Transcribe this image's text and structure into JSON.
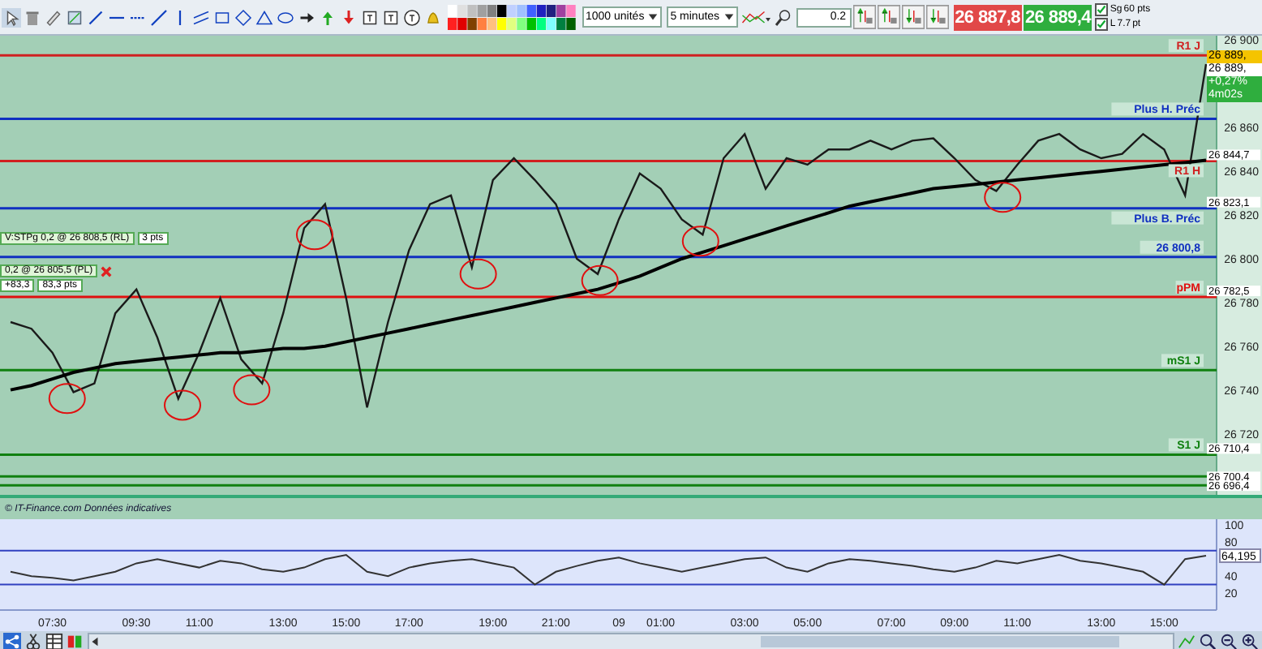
{
  "toolbar": {
    "quantity_select": "1000 unités",
    "interval_select": "5 minutes",
    "quantity_field": "0.2",
    "sell_price": "26 887,8",
    "buy_price": "26 889,4",
    "options": [
      {
        "label": "Sg",
        "checked": true,
        "value": "60 pts"
      },
      {
        "label": "L",
        "checked": true,
        "value": "7.7",
        "unit": "pt"
      }
    ]
  },
  "price_chart": {
    "chart_data": {
      "type": "line",
      "ylim": [
        26692,
        26902
      ],
      "yticks": [
        {
          "value": 26720,
          "label": "26 720"
        },
        {
          "value": 26740,
          "label": "26 740"
        },
        {
          "value": 26760,
          "label": "26 760"
        },
        {
          "value": 26780,
          "label": "26 780"
        },
        {
          "value": 26800,
          "label": "26 800"
        },
        {
          "value": 26820,
          "label": "26 820"
        },
        {
          "value": 26840,
          "label": "26 840"
        },
        {
          "value": 26860,
          "label": "26 860"
        },
        {
          "value": 26900,
          "label": "26 900"
        }
      ],
      "categories": [
        null,
        null,
        null,
        null,
        null,
        null,
        null,
        null,
        null,
        null,
        null,
        null,
        null,
        null,
        null,
        null,
        null,
        null,
        null,
        null,
        null,
        null,
        null,
        null,
        null,
        null,
        null,
        null,
        null,
        null,
        null,
        null,
        null,
        null,
        null,
        null,
        null,
        null,
        null,
        null,
        null,
        null,
        null,
        null,
        null,
        null,
        null,
        null,
        null,
        null,
        null,
        null,
        null,
        null,
        null,
        null,
        null,
        null
      ],
      "series": [
        {
          "color": "#1a1a1a",
          "values": [
            26771,
            26768,
            26757,
            26739,
            26743,
            26775,
            26786,
            26764,
            26736,
            26757,
            26782,
            26754,
            26743,
            26775,
            26814,
            26825,
            26782,
            26732,
            26771,
            26804,
            26825,
            26829,
            26796,
            26836,
            26846,
            26836,
            26825,
            26800,
            26793,
            26818,
            26839,
            26832,
            26818,
            26811,
            26846,
            26857,
            26832,
            26846,
            26843,
            26850,
            26850,
            26854,
            26850,
            26854,
            26855,
            26846,
            26836,
            26831,
            26843,
            26854,
            26857,
            26850,
            26846,
            26848,
            26857,
            26850,
            26829,
            26889
          ]
        },
        {
          "color": "#000000",
          "values": [
            26740,
            26742,
            26745,
            26748,
            26750,
            26752,
            26753,
            26754,
            26755,
            26756,
            26757,
            26757,
            26758,
            26759,
            26759,
            26760,
            26762,
            26764,
            26766,
            26768,
            26770,
            26772,
            26774,
            26776,
            26778,
            26780,
            26782,
            26784,
            26786,
            26789,
            26792,
            26796,
            26800,
            26803,
            26806,
            26809,
            26812,
            26815,
            26818,
            26821,
            26824,
            26826,
            26828,
            26830,
            26832,
            26833,
            26834,
            26835,
            26836,
            26837,
            26838,
            26839,
            26840,
            26841,
            26842,
            26843,
            26844,
            26845
          ]
        }
      ],
      "ref_lines": [
        {
          "axis": "y",
          "value": 26893,
          "label": "R1 J",
          "color": "#d02020"
        },
        {
          "axis": "y",
          "value": 26864,
          "label": "Plus H. Préc",
          "color": "#1030c0"
        },
        {
          "axis": "y",
          "value": 26844.7,
          "label": "R1 H",
          "color": "#d02020"
        },
        {
          "axis": "y",
          "value": 26823.1,
          "label": "Plus B. Préc",
          "color": "#1030c0"
        },
        {
          "axis": "y",
          "value": 26800.8,
          "label": "26 800,8",
          "color": "#1030c0"
        },
        {
          "axis": "y",
          "value": 26782.5,
          "label": "pPM",
          "color": "#e01010"
        },
        {
          "axis": "y",
          "value": 26749,
          "label": "mS1 J",
          "color": "#108010"
        },
        {
          "axis": "y",
          "value": 26710.4,
          "label": "S1 J",
          "color": "#108010"
        },
        {
          "axis": "y",
          "value": 26700.4,
          "color": "#108010"
        },
        {
          "axis": "y",
          "value": 26696.4,
          "color": "#108010"
        }
      ],
      "annotations": [
        "26 844,7",
        "26 823,1",
        "26 782,5",
        "26 710,4",
        "26 700,4",
        "26 696,4"
      ]
    },
    "readouts": [
      {
        "text": "26 889,",
        "kind": "last"
      },
      {
        "text": "26 889,",
        "kind": "plain"
      },
      {
        "text": "+0,27%",
        "kind": "change"
      },
      {
        "text": "4m02s",
        "kind": "change"
      }
    ],
    "orders": [
      {
        "label": "V:STPg 0,2 @ 26 808,5 (RL)",
        "value": "3 pts",
        "closable": false
      },
      {
        "label": "0,2 @ 26 805,5 (PL)",
        "value": "+83,3",
        "extra": "83,3 pts",
        "closable": true
      }
    ]
  },
  "source_note": "© IT-Finance.com Données indicatives",
  "oscillator": {
    "reading": "64,195",
    "chart_data": {
      "type": "line",
      "ylim": [
        0,
        107
      ],
      "yticks": [
        20,
        40,
        80,
        100
      ],
      "categories": [
        null,
        null,
        "07:30",
        null,
        null,
        null,
        "09:30",
        null,
        null,
        "11:00",
        null,
        null,
        null,
        "13:00",
        null,
        null,
        "15:00",
        null,
        null,
        "17:00",
        null,
        null,
        null,
        "19:00",
        null,
        null,
        "21:00",
        null,
        null,
        "09",
        null,
        "01:00",
        null,
        null,
        null,
        "03:00",
        null,
        null,
        "05:00",
        null,
        null,
        null,
        "07:00",
        null,
        null,
        "09:00",
        null,
        null,
        "11:00",
        null,
        null,
        null,
        "13:00",
        null,
        null,
        "15:00",
        null,
        null
      ],
      "series": [
        {
          "color": "#333333",
          "values": [
            45,
            40,
            38,
            35,
            40,
            45,
            55,
            60,
            55,
            50,
            58,
            55,
            48,
            45,
            50,
            60,
            65,
            45,
            40,
            50,
            55,
            58,
            60,
            55,
            50,
            30,
            45,
            52,
            58,
            62,
            55,
            50,
            45,
            50,
            55,
            60,
            62,
            50,
            45,
            55,
            60,
            58,
            55,
            52,
            48,
            45,
            50,
            58,
            55,
            60,
            65,
            58,
            55,
            50,
            45,
            30,
            60,
            64
          ]
        }
      ],
      "ref_lines": [
        {
          "axis": "y",
          "value": 70
        },
        {
          "axis": "y",
          "value": 30
        }
      ]
    }
  }
}
